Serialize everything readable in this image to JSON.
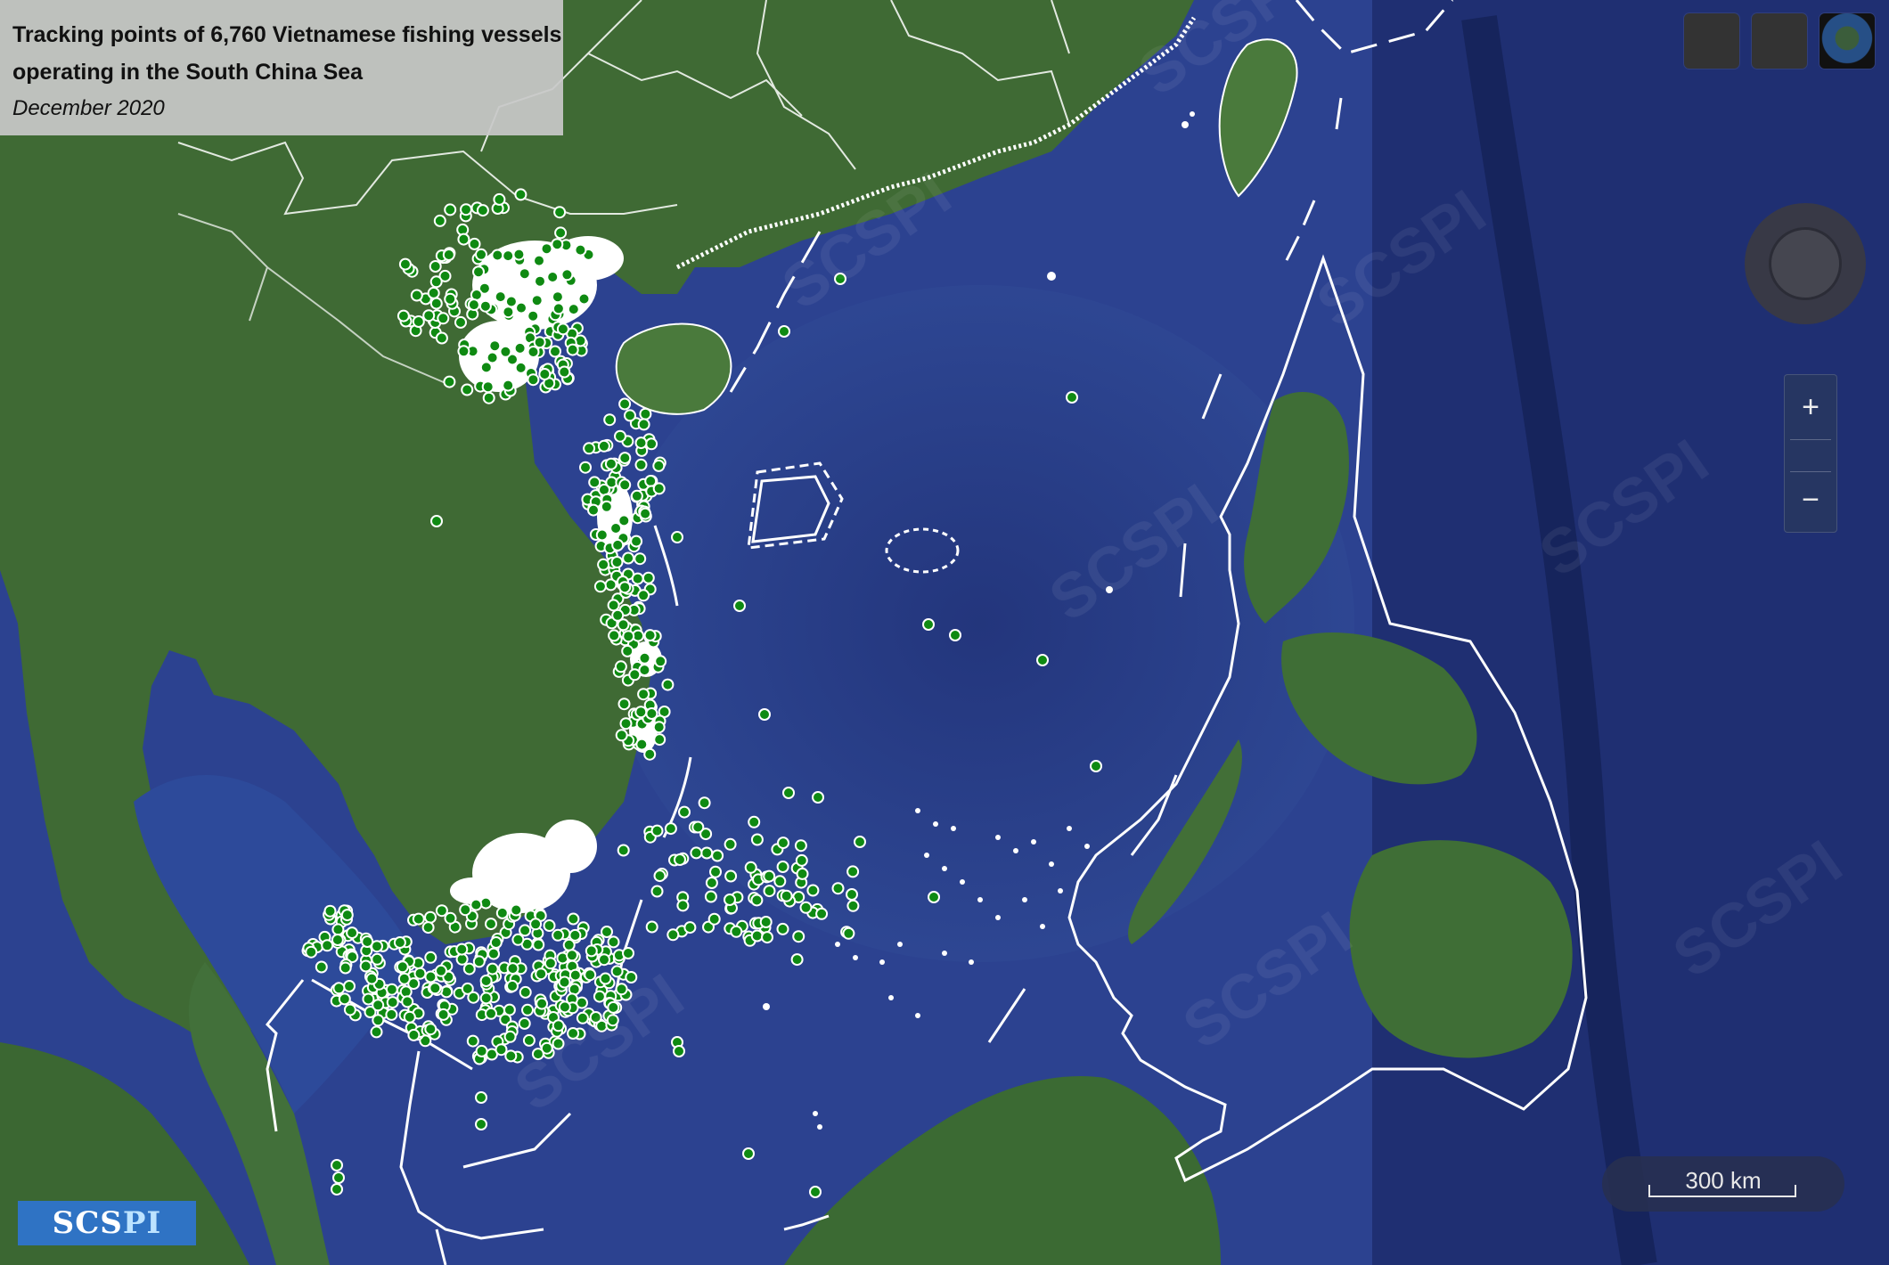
{
  "title": {
    "line1": "Tracking points of 6,760 Vietnamese fishing vessels",
    "line2": "operating in the South China Sea",
    "date": "December 2020"
  },
  "controls": {
    "zoom_in": "+",
    "zoom_out": "−",
    "scale_label": "300 km"
  },
  "logo": {
    "prefix": "SCS",
    "accent": "PI"
  },
  "watermark": "SCSPI",
  "colors": {
    "sea": "#2a3f8c",
    "land": "#3f6a34",
    "vessel_point": "#0f8a12",
    "point_outline": "#ffffff",
    "boundary": "#ffffff",
    "logo_bg": "#2f73c4"
  },
  "icons": [
    "layer-icon",
    "satellite-icon",
    "compass-icon"
  ]
}
